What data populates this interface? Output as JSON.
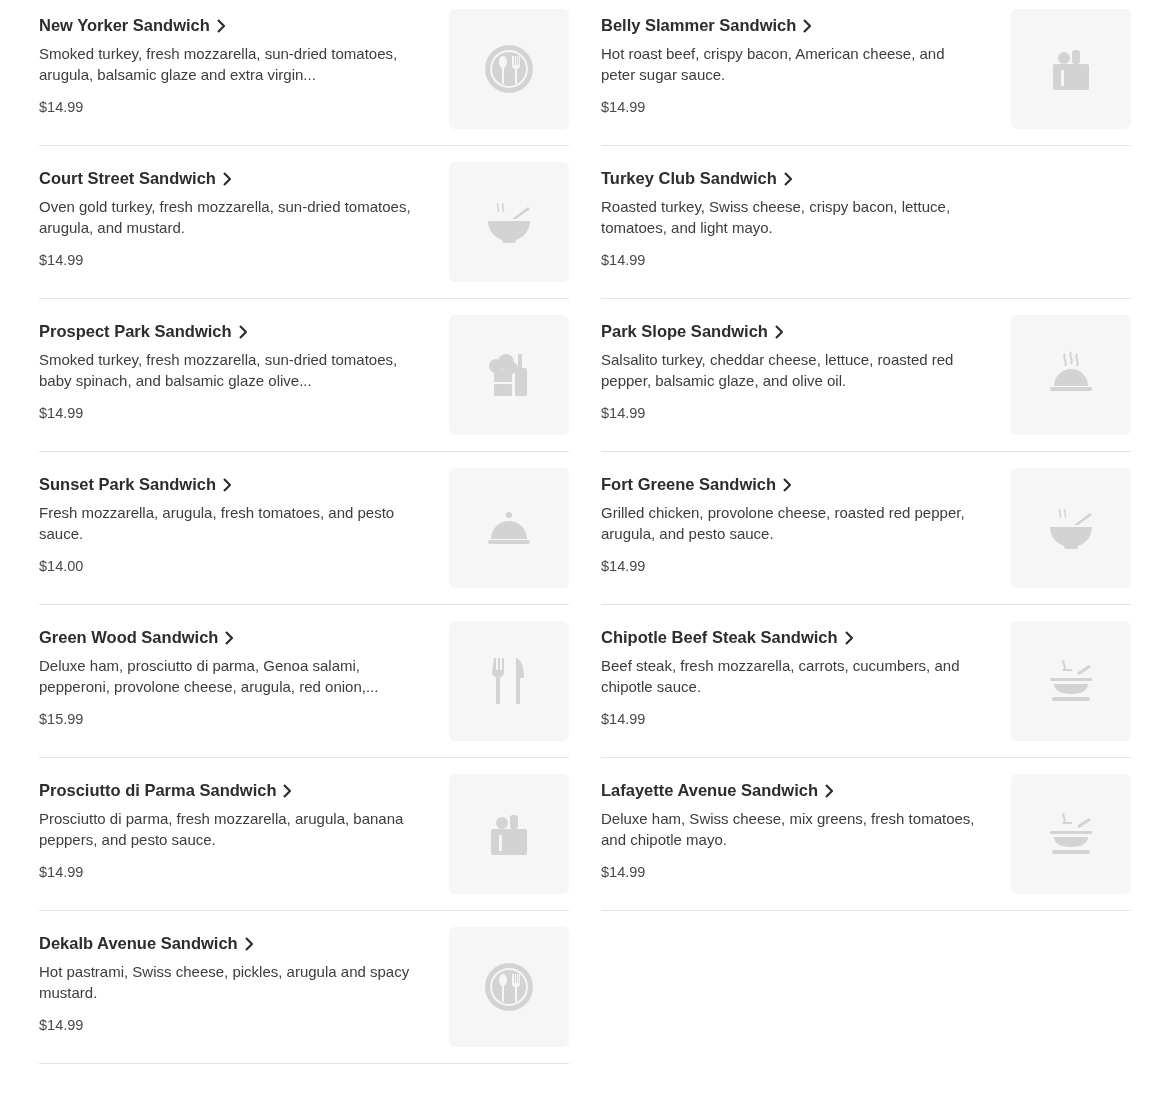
{
  "menu_items": [
    {
      "name": "New Yorker Sandwich",
      "description": "Smoked turkey, fresh mozzarella, sun-dried tomatoes, arugula, balsamic glaze and extra virgin...",
      "price": "$14.99",
      "image": {
        "kind": "plate"
      }
    },
    {
      "name": "Belly Slammer Sandwich",
      "description": "Hot roast beef, crispy bacon, American cheese, and peter sugar sauce.",
      "price": "$14.99",
      "image": {
        "kind": "grocery"
      }
    },
    {
      "name": "Court Street Sandwich",
      "description": "Oven gold turkey, fresh mozzarella, sun-dried tomatoes, arugula, and mustard.",
      "price": "$14.99",
      "image": {
        "kind": "bowl"
      }
    },
    {
      "name": "Turkey Club Sandwich",
      "description": "Roasted turkey, Swiss cheese, crispy bacon, lettuce, tomatoes, and light mayo.",
      "price": "$14.99"
    },
    {
      "name": "Prospect Park Sandwich",
      "description": "Smoked turkey, fresh mozzarella, sun-dried tomatoes, baby spinach, and balsamic glaze olive...",
      "price": "$14.99",
      "image": {
        "kind": "chef"
      }
    },
    {
      "name": "Park Slope Sandwich",
      "description": "Salsalito turkey, cheddar cheese, lettuce, roasted red pepper, balsamic glaze, and olive oil.",
      "price": "$14.99",
      "image": {
        "kind": "hot-dish"
      }
    },
    {
      "name": "Sunset Park Sandwich",
      "description": "Fresh mozzarella, arugula, fresh tomatoes, and pesto sauce.",
      "price": "$14.00",
      "image": {
        "kind": "cloche"
      }
    },
    {
      "name": "Fort Greene Sandwich",
      "description": "Grilled chicken, provolone cheese, roasted red pepper, arugula, and pesto sauce.",
      "price": "$14.99",
      "image": {
        "kind": "bowl"
      }
    },
    {
      "name": "Green Wood Sandwich",
      "description": "Deluxe ham, prosciutto di parma, Genoa salami, pepperoni, provolone cheese, arugula, red onion,...",
      "price": "$15.99",
      "image": {
        "kind": "cutlery"
      }
    },
    {
      "name": "Chipotle Beef Steak Sandwich",
      "description": "Beef steak, fresh mozzarella, carrots, cucumbers, and chipotle sauce.",
      "price": "$14.99",
      "image": {
        "kind": "stack"
      }
    },
    {
      "name": "Prosciutto di Parma Sandwich",
      "description": "Prosciutto di parma, fresh mozzarella, arugula, banana peppers, and pesto sauce.",
      "price": "$14.99",
      "image": {
        "kind": "grocery"
      }
    },
    {
      "name": "Lafayette Avenue Sandwich",
      "description": "Deluxe ham, Swiss cheese, mix greens, fresh tomatoes, and chipotle mayo.",
      "price": "$14.99",
      "image": {
        "kind": "stack"
      }
    },
    {
      "name": "Dekalb Avenue Sandwich",
      "description": "Hot pastrami, Swiss cheese, pickles, arugula and spacy mustard.",
      "price": "$14.99",
      "image": {
        "kind": "plate"
      }
    }
  ]
}
